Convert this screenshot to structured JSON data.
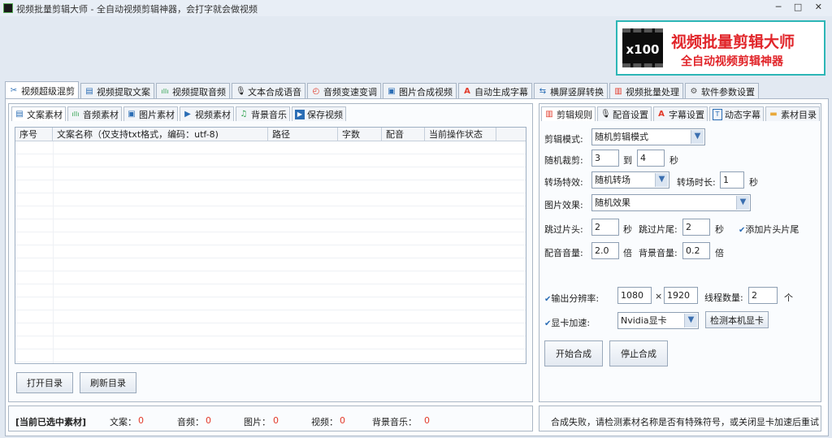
{
  "window": {
    "title": "视频批量剪辑大师 - 全自动视频剪辑神器，会打字就会做视频",
    "controls": "─ □ ✕"
  },
  "banner": {
    "badge": "x100",
    "title": "视频批量剪辑大师",
    "subtitle": "全自动视频剪辑神器"
  },
  "main_tabs": [
    {
      "label": "视频超级混剪",
      "icon": "✂"
    },
    {
      "label": "视频提取文案",
      "icon": "▤"
    },
    {
      "label": "视频提取音频",
      "icon": "ıllı"
    },
    {
      "label": "文本合成语音",
      "icon": "🎙"
    },
    {
      "label": "音频变速变调",
      "icon": "◴"
    },
    {
      "label": "图片合成视频",
      "icon": "▣"
    },
    {
      "label": "自动生成字幕",
      "icon": "A"
    },
    {
      "label": "横屏竖屏转换",
      "icon": "⇆"
    },
    {
      "label": "视频批量处理",
      "icon": "▥"
    },
    {
      "label": "软件参数设置",
      "icon": "⚙"
    }
  ],
  "left_tabs": [
    {
      "label": "文案素材",
      "icon": "▤"
    },
    {
      "label": "音频素材",
      "icon": "ıllı"
    },
    {
      "label": "图片素材",
      "icon": "▣"
    },
    {
      "label": "视频素材",
      "icon": "▶"
    },
    {
      "label": "背景音乐",
      "icon": "♫"
    },
    {
      "label": "保存视频",
      "icon": "▶"
    }
  ],
  "table": {
    "columns": [
      "序号",
      "文案名称（仅支持txt格式，编码：utf-8)",
      "路径",
      "字数",
      "配音",
      "当前操作状态",
      ""
    ]
  },
  "left_buttons": {
    "open": "打开目录",
    "refresh": "刷新目录"
  },
  "selected_summary": {
    "label": "[当前已选中素材]",
    "items": [
      {
        "label": "文案：",
        "value": "0"
      },
      {
        "label": "音频：",
        "value": "0"
      },
      {
        "label": "图片：",
        "value": "0"
      },
      {
        "label": "视频：",
        "value": "0"
      },
      {
        "label": "背景音乐：",
        "value": "0"
      }
    ]
  },
  "right_tabs": [
    {
      "label": "剪辑规则",
      "icon": "▥"
    },
    {
      "label": "配音设置",
      "icon": "🎙"
    },
    {
      "label": "字幕设置",
      "icon": "A"
    },
    {
      "label": "动态字幕",
      "icon": "T"
    },
    {
      "label": "素材目录",
      "icon": "▬"
    }
  ],
  "settings": {
    "mode_label": "剪辑模式:",
    "mode_value": "随机剪辑模式",
    "cut_label": "随机裁剪:",
    "cut_from": "3",
    "cut_to_label": "到",
    "cut_to": "4",
    "cut_unit": "秒",
    "trans_label": "转场特效:",
    "trans_value": "随机转场",
    "trans_dur_label": "转场时长:",
    "trans_dur": "1",
    "trans_unit": "秒",
    "img_label": "图片效果:",
    "img_value": "随机效果",
    "skip_head_label": "跳过片头:",
    "skip_head": "2",
    "skip_head_unit": "秒",
    "skip_tail_label": "跳过片尾:",
    "skip_tail": "2",
    "skip_tail_unit": "秒",
    "add_head_tail": "添加片头片尾",
    "voice_vol_label": "配音音量:",
    "voice_vol": "2.0",
    "voice_vol_unit": "倍",
    "bg_vol_label": "背景音量:",
    "bg_vol": "0.2",
    "bg_vol_unit": "倍",
    "res_label": "输出分辨率:",
    "res_w": "1080",
    "res_x": "×",
    "res_h": "1920",
    "threads_label": "线程数量:",
    "threads": "2",
    "threads_unit": "个",
    "gpu_label": "显卡加速:",
    "gpu_value": "Nvidia显卡",
    "detect_gpu": "检测本机显卡",
    "start": "开始合成",
    "stop": "停止合成"
  },
  "status_message": "合成失败，请检测素材名称是否有特殊符号，或关闭显卡加速后重试",
  "colors": {
    "accent_red": "#e23a2a",
    "banner_border": "#2cb6b6",
    "checkbox_blue": "#2a6db5"
  }
}
